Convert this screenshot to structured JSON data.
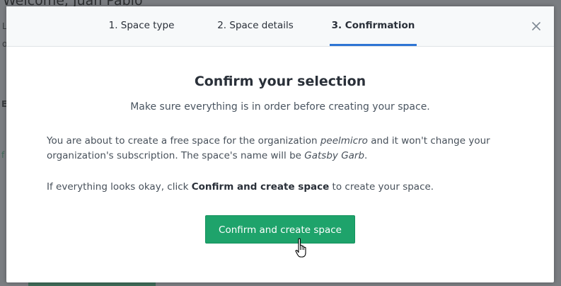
{
  "background": {
    "title": "Welcome, Juan Pablo",
    "side_letters": [
      "L",
      "o",
      "E",
      "f"
    ]
  },
  "wizard": {
    "tabs": [
      {
        "label": "1. Space type",
        "active": false
      },
      {
        "label": "2. Space details",
        "active": false
      },
      {
        "label": "3. Confirmation",
        "active": true
      }
    ],
    "close_icon": "close-icon"
  },
  "content": {
    "title": "Confirm your selection",
    "subtitle": "Make sure everything is in order before creating your space.",
    "para1": {
      "t1": "You are about to create a free space for the organization ",
      "org": "peelmicro",
      "t2": " and it won't change your organization's subscription. The space's name will be ",
      "space": "Gatsby Garb",
      "t3": "."
    },
    "para2": {
      "t1": "If everything looks okay, click ",
      "bold": "Confirm and create space",
      "t2": " to create your space."
    },
    "confirm_button": "Confirm and create space"
  },
  "colors": {
    "accent": "#2e75d4",
    "button": "#1ea36b",
    "overlay": "#7a7d81"
  }
}
